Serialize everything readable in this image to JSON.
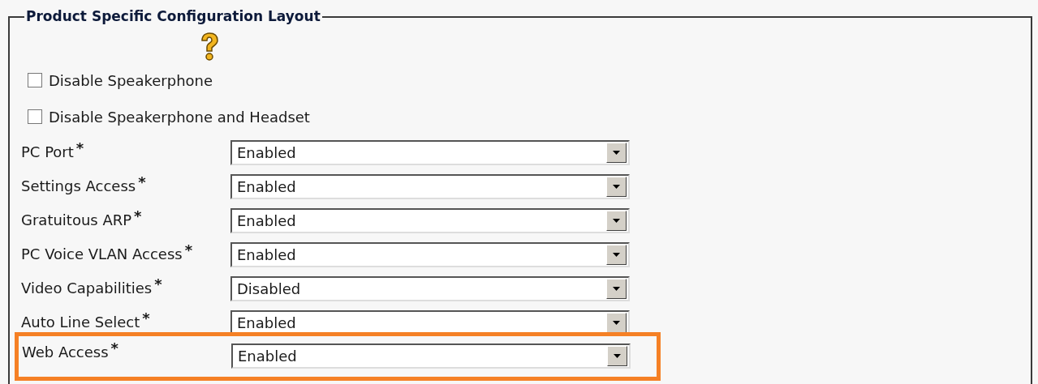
{
  "section": {
    "title": "Product Specific Configuration Layout"
  },
  "checkboxes": [
    {
      "label": "Disable Speakerphone",
      "checked": false
    },
    {
      "label": "Disable Speakerphone and Headset",
      "checked": false
    }
  ],
  "fields": [
    {
      "label": "PC Port",
      "required_mark": "*",
      "value": "Enabled",
      "highlighted": false
    },
    {
      "label": "Settings Access",
      "required_mark": "*",
      "value": "Enabled",
      "highlighted": false
    },
    {
      "label": "Gratuitous ARP",
      "required_mark": "*",
      "value": "Enabled",
      "highlighted": false
    },
    {
      "label": "PC Voice VLAN Access",
      "required_mark": "*",
      "value": "Enabled",
      "highlighted": false
    },
    {
      "label": "Video Capabilities",
      "required_mark": "*",
      "value": "Disabled",
      "highlighted": false
    },
    {
      "label": "Auto Line Select",
      "required_mark": "*",
      "value": "Enabled",
      "highlighted": false
    },
    {
      "label": "Web Access",
      "required_mark": "*",
      "value": "Enabled",
      "highlighted": true
    }
  ]
}
